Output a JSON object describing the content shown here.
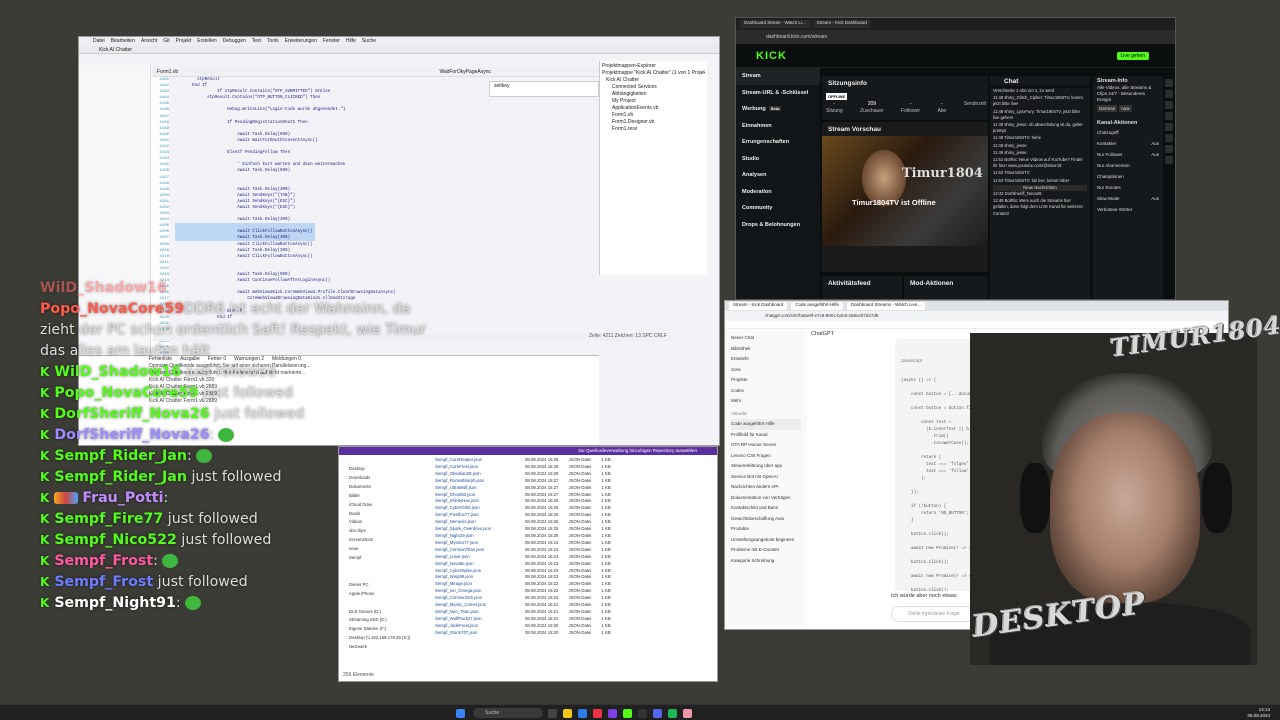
{
  "vs": {
    "title": "Kick AI Chatter",
    "menu": [
      "Datei",
      "Bearbeiten",
      "Ansicht",
      "Git",
      "Projekt",
      "Erstellen",
      "Debuggen",
      "Test",
      "Tools",
      "Erweiterungen",
      "Fenster",
      "Hilfe",
      "Suche"
    ],
    "tab": "Form1.vb",
    "method": "WaitForOkyPageAsync",
    "search_value": "seitkey",
    "gutter": "4181\n4182\n4183\n4184\n4185\n4186\n4187\n4188\n4189\n4190\n4191\n4192\n4193\n4194\n4195\n4196\n4197\n4198\n4199\n4200\n4201\n4202\n4203\n4204\n4205\n4206\n4207\n4208\n4209\n4210\n4211\n4212\n4213\n4214\n4215\n4216\n4217\n4218\n4219\n4220\n4221\n4222\n4223\n4224\n4225\n4226\n4227",
    "code": "        stpResult\n      End If\n                If stpResult.Contains(\"OTP_SUBMITTED\") OrElse\n            stpResult.Contains(\"OTP_BUTTON_CLICKED\") Then\n\n                    Debug.WriteLine(\"Login-Code wurde abgesendet.\")\n\n                    If PendingRegistrationOAuth Then\n\n                        Await Task.Delay(600)\n                        Await WaitForOAuthConsentAsync()\n\n                    ElseIf PendingFollow Then\n\n                        ' Einfach kurz warten und dann weitermachen\n                        Await Task.Delay(600)\n\n\n                        Await Task.Delay(300)\n                        Await SendKeys(\"{TAB}\")\n                        Await SendKeys(\"{ESC}\")\n                        Await SendKeys(\"{ESC}\")\n\n                        Await Task.Delay(300)\n\n                        Await ClickFollowButtonAsync()\n                        Await Task.Delay(300)\n                        Await ClickFollowButtonAsync()\n                        Await Task.Delay(300)\n                        Await ClickFollowButtonAsync()\n\n\n                        Await Task.Delay(500)\n                        Await ContinueFollowAfterLoginAsync()\n\n                        Await WebView2Kick.CoreWebView2.Profile.ClearBrowsingDataAsync(\n                            CoreWebView2BrowsingDataKinds.AllDomStorage\n\n                    End If\n                End If",
    "explorer": [
      "Projektmappen-Explorer",
      "Projektmappe \"Kick AI Chatter\" (1 von 1 Projekt)",
      "Kick AI Chatter",
      "Connected Services",
      "Abhängigkeiten",
      "My Project",
      "ApplicationEvents.vb",
      "Form1.vb",
      "Form1.Designer.vb",
      "Form1.resx"
    ],
    "status": "Zeile: 4211   Zeichen: 13   SPC   CRLF",
    "output_tabs": [
      "Fehlerliste",
      "Ausgabe",
      "Fehler 0",
      "Warnungen 2",
      "Meldungen 0"
    ],
    "output_lines": [
      "Opmizer Quellkoode ausgeführt. Sie auf einer sicheren Parallelisierung...",
      "Opmizer Quellkoode ausgeführt. Hier Referenzen auf nicht markierte...",
      "Kick AI Chatter   Form1.vb   320",
      "Kick AI Chatter   Form1.vb   2889",
      "Kick AI Chatter   Form1.vb   2889",
      "Kick AI Chatter   Form1.vb   2889"
    ]
  },
  "explorer_window": {
    "bar_text": "Zur Quellcodeverwaltung hinzufügen      Repository auswählen",
    "nav": [
      "Desktop",
      "Downloads",
      "Dokumente",
      "Bilder",
      "iCloud Drive",
      "Musik",
      "Videos",
      "obs clips",
      "Screenshots",
      "neue",
      "Sempf",
      "",
      "",
      "Dieser PC",
      "Apple iPhone",
      "",
      "DLD Games (D:)",
      "Streaming SSD (E:)",
      "Eigene Dateien (F:)",
      "Desktop (\\\\ 192.168.178.26 (S:))",
      "Netzwerk"
    ],
    "files": [
      {
        "name": "Sempf_CoreReaper.json",
        "date": "08.08.2024 15:28",
        "type": "JSON-Datei",
        "size": "1 KB"
      },
      {
        "name": "Sempf_CoreFrost.json",
        "date": "08.08.2024 15:28",
        "type": "JSON-Datei",
        "size": "1 KB"
      },
      {
        "name": "Sempf_Obsidian28.json",
        "date": "08.08.2024 15:28",
        "type": "JSON-Datei",
        "size": "1 KB"
      },
      {
        "name": "Sempf_RocketMorph.json",
        "date": "08.08.2024 15:27",
        "type": "JSON-Datei",
        "size": "1 KB"
      },
      {
        "name": "Sempf_UltraWolf.json",
        "date": "08.08.2024 15:27",
        "type": "JSON-Datei",
        "size": "1 KB"
      },
      {
        "name": "Sempf_Ghost60.json",
        "date": "08.08.2024 15:27",
        "type": "JSON-Datei",
        "size": "1 KB"
      },
      {
        "name": "Sempf_InfinityHax.json",
        "date": "08.08.2024 15:26",
        "type": "JSON-Datei",
        "size": "1 KB"
      },
      {
        "name": "Sempf_CyberOrbit.json",
        "date": "08.08.2024 15:26",
        "type": "JSON-Datei",
        "size": "1 KB"
      },
      {
        "name": "Sempf_Pixelfox77.json",
        "date": "08.08.2024 15:26",
        "type": "JSON-Datei",
        "size": "1 KB"
      },
      {
        "name": "Sempf_Nemesis.json",
        "date": "08.08.2024 15:25",
        "type": "JSON-Datei",
        "size": "1 KB"
      },
      {
        "name": "Sempf_Spark_Overdrive.json",
        "date": "08.08.2024 15:25",
        "type": "JSON-Datei",
        "size": "1 KB"
      },
      {
        "name": "Sempf_Night19.json",
        "date": "08.08.2024 15:25",
        "type": "JSON-Datei",
        "size": "1 KB"
      },
      {
        "name": "Sempf_Mystics77.json",
        "date": "08.08.2024 15:24",
        "type": "JSON-Datei",
        "size": "1 KB"
      },
      {
        "name": "Sempf_CrimsonTitan.json",
        "date": "08.08.2024 15:24",
        "type": "JSON-Datei",
        "size": "1 KB"
      },
      {
        "name": "Sempf_Lunar.json",
        "date": "08.08.2024 15:24",
        "type": "JSON-Datei",
        "size": "1 KB"
      },
      {
        "name": "Sempf_Nova66.json",
        "date": "08.08.2024 15:23",
        "type": "JSON-Datei",
        "size": "1 KB"
      },
      {
        "name": "Sempf_CyberSpike.json",
        "date": "08.08.2024 15:23",
        "type": "JSON-Datei",
        "size": "1 KB"
      },
      {
        "name": "Sempf_Wisp99.json",
        "date": "08.08.2024 15:23",
        "type": "JSON-Datei",
        "size": "1 KB"
      },
      {
        "name": "Sempf_Mirage.json",
        "date": "08.08.2024 15:22",
        "type": "JSON-Datei",
        "size": "1 KB"
      },
      {
        "name": "Sempf_Ion_Omega.json",
        "date": "08.08.2024 15:22",
        "type": "JSON-Datei",
        "size": "1 KB"
      },
      {
        "name": "Sempf_CrimsonOrb.json",
        "date": "08.08.2024 15:22",
        "type": "JSON-Datei",
        "size": "1 KB"
      },
      {
        "name": "Sempf_Mystic_Comet.json",
        "date": "08.08.2024 15:21",
        "type": "JSON-Datei",
        "size": "1 KB"
      },
      {
        "name": "Sempf_Neo_Titan.json",
        "date": "08.08.2024 15:21",
        "type": "JSON-Datei",
        "size": "1 KB"
      },
      {
        "name": "Sempf_WolfPack27.json",
        "date": "08.08.2024 15:21",
        "type": "JSON-Datei",
        "size": "1 KB"
      },
      {
        "name": "Sempf_JadeFrost.json",
        "date": "08.08.2024 15:20",
        "type": "JSON-Datei",
        "size": "1 KB"
      },
      {
        "name": "Sempf_Storm707.json",
        "date": "08.08.2024 15:20",
        "type": "JSON-Datei",
        "size": "1 KB"
      }
    ],
    "status": "259 Elemente"
  },
  "kick": {
    "tabs": [
      "Dashboard Strean - Watch Li...",
      "Stream - Kick Dashboard"
    ],
    "url": "dashboard.kick.com/stream",
    "logo": "KICK",
    "live_label": "Live gehen",
    "sidebar": [
      "Stream",
      "Stream-URL & -Schlüssel",
      "Werbung",
      "Einnahmen",
      "Errungenschaften",
      "Studio",
      "Analysen",
      "Moderation",
      "Community",
      "Drops & Belohnungen"
    ],
    "werbung_badge": "Beta",
    "session_title": "Sitzungsinfo",
    "offline": "OFFLINE",
    "stats_values": [
      "-",
      "209",
      "-",
      "-"
    ],
    "stats_labels": [
      "Sitzung",
      "Zuschauer",
      "Follower",
      "Abo",
      "Sendezeit"
    ],
    "preview_title": "Stream Vorschau",
    "offline_text": "Timur1804TV ist Offline",
    "banner_name": "Timur1804",
    "activity_title": "Aktivitätsfeed",
    "mod_title": "Mod-Aktionen",
    "activity_name": "Timur1804",
    "activity_sub": "folgt jetzt dem Kanal",
    "chat_title": "Chat",
    "chat_lines": [
      "Verschenke 1 Abo um 1, zu werd",
      "11:48 shmy_Glitch_Cipher: Timur1804TV, komm jetzt bitte live!",
      "11:48 shmy_LynxFury: Timur1804TV, jetzt bitte live gehen!",
      "11:49 shmy_jesse: ob abwechslung ist da, geiler prompt",
      "11:49 Timur1804TV: hehe",
      "11:49 shmy_jesse:",
      "11:49 shmy_jesse:",
      "11:52 BotRix: Neue Videos auf YouTube? Findet ihr hier! www.youtube.com/@timur18",
      "11:52 Timur1804TV:",
      "11:53 Timur1804TV: bin live, komm rüber",
      "Neue Nachrichten",
      "12:43 DorfSheriff_Nova26:",
      "12:48 BotRix: Wem auch die Streams hier gefallen, dann folgt dem LIVE Kanal für weiteren Content!"
    ],
    "stream_info_title": "Stream-Info",
    "stream_info_text": "Alle Videos, alle Streams & Clips 24/7 - Besonderes Ereigni",
    "tags": [
      "German",
      "now"
    ],
    "channel_actions_title": "Kanal-Aktionen",
    "chat_rules": [
      {
        "label": "Chatzugriff",
        "val": ""
      },
      {
        "label": "Kontakter",
        "val": "Aus"
      },
      {
        "label": "Nur Follower",
        "val": "Aus"
      },
      {
        "label": "Nur Abonnenten",
        "val": ""
      },
      {
        "label": "Chatoptionen",
        "val": ""
      },
      {
        "label": "Nur Emotes",
        "val": ""
      },
      {
        "label": "Slow-Mode",
        "val": "Aus"
      },
      {
        "label": "Verbotene Wörter",
        "val": ""
      }
    ]
  },
  "gpt": {
    "tabs": [
      "Stream - Kick Dashboard",
      "Code ausgeführt-Hilfe",
      "Dashboard Streams - Watch Live..."
    ],
    "url": "chatgpt.com/c/67ba5e9f-e7c8-8001-b4c8-2a8ceb7d27d8",
    "title": "ChatGPT",
    "sidebar": [
      "Neuer Chat",
      "Bibliothek",
      "Entwürfe",
      "Sora",
      "Projekte",
      "Codex",
      "Mehr",
      "Aktuelle",
      "Code ausgeführt Hilfe",
      "Profilbild für Kanal",
      "GTA RP Humor Server",
      "Lenovo C30 Fragen",
      "Steuererklärung über app",
      "Service Bot mit OpenAI",
      "Nachrichten ändern API",
      "Dokumentation von Verträgen",
      "Kontaktschild und Bans",
      "Gewichtsbeschaffung Auto Produkte",
      "Umstellungsangebote beginnen",
      "Probleme mit E-Gooster",
      "Kategorie Schreibung"
    ],
    "code_label": "JavaScript",
    "code": "(async () => {\n\n    const button = [...document\n\n    const button = button.find(b\n\n        const text =\n          (b.innerText || b.te\n            .trim()\n            .toLowerCase();\n\n        return (\n          text === 'folgen' ||\n          text === 'follow'\n        );\n\n    });\n\n    if (!button) {\n        return 'NO_BUTTON';\n    }\n\n    button.click();\n\n    await new Promise(r => setTim\n\n    button.click();\n\n    await new Promise(r => setTim\n\n    button.click();\n\n    return 'CLICKED';\n})();",
    "prompt": "Ich würde aber noch etwas",
    "input_placeholder": "Stelle irgendeine Frage"
  },
  "cam": {
    "logo_top": "TIMUR1804",
    "logo_bottom": "DESKTOP"
  },
  "overlay": {
    "lines": [
      {
        "user": "WilD_Shadow16",
        "color": "#ff6b6b",
        "msg": "",
        "dim": true,
        "k": false
      },
      {
        "user": "Popo_NovaCore59",
        "color": "#ff5a4a",
        "msg": "DDR6 ist echt der Wahnsinn, da",
        "k": false
      },
      {
        "user": "",
        "color": "#dcdcdc",
        "msg": "zieht der PC schon ordentlich Saft! Respekt, wie Timur",
        "k": false
      },
      {
        "user": "",
        "color": "#dcdcdc",
        "msg": "das alles am laufen hält",
        "k": false
      },
      {
        "user": "WilD_Shadow16",
        "color": "#53fc18",
        "msg": " just followed",
        "k": true
      },
      {
        "user": "Popo_NovaCore59",
        "color": "#53fc18",
        "msg": " just followed",
        "k": true
      },
      {
        "user": "DorfSheriff_Nova26",
        "color": "#53fc18",
        "msg": " just followed",
        "k": true
      },
      {
        "user": "DorfSheriff_Nova26",
        "color": "#9b8cff",
        "msg": ":",
        "k": true,
        "emote": true
      },
      {
        "user": "Sempf_Rider_Jan",
        "color": "#53fc18",
        "msg": ":",
        "k": true,
        "emote": true
      },
      {
        "user": "Sempf_Rider_Jan",
        "color": "#53fc18",
        "msg": " just followed",
        "k": true
      },
      {
        "user": "Frau_Potti",
        "color": "#c08cff",
        "msg": ":",
        "k": true,
        "badges": true
      },
      {
        "user": "Sempf_Fire77",
        "color": "#53fc18",
        "msg": " just followed",
        "k": true
      },
      {
        "user": "Sempf_Nico522",
        "color": "#53fc18",
        "msg": " just followed",
        "k": true
      },
      {
        "user": "Sempf_Frost",
        "color": "#ff5aa0",
        "msg": ":",
        "k": true,
        "emote": true
      },
      {
        "user": "Sempf_Frost",
        "color": "#6e7bff",
        "msg": " just followed",
        "k": true
      },
      {
        "user": "Sempf_Night91",
        "color": "#ffffff",
        "msg": ":",
        "k": true,
        "emote": true
      }
    ]
  },
  "taskbar": {
    "search": "Suche",
    "time": "14:13",
    "date": "08.08.2024"
  }
}
